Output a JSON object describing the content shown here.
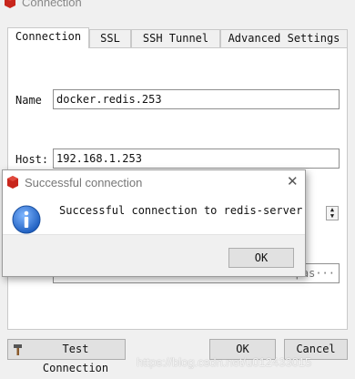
{
  "window": {
    "title": "Connection"
  },
  "tabs": [
    {
      "label": "Connection"
    },
    {
      "label": "SSL"
    },
    {
      "label": "SSH Tunnel"
    },
    {
      "label": "Advanced Settings"
    }
  ],
  "form": {
    "name_label": "Name",
    "name_value": "docker.redis.253",
    "host_label": "Host:",
    "host_value": "192.168.1.253",
    "auth_value_partial": "pas···"
  },
  "buttons": {
    "test_connection": "Test Connection",
    "ok": "OK",
    "cancel": "Cancel"
  },
  "watermark": "https://blog.csdn.net/u012433015",
  "dialog": {
    "title": "Successful connection",
    "message": "Successful connection to redis-server",
    "ok": "OK",
    "close_symbol": "✕"
  },
  "colors": {
    "redis_red": "#c8261c",
    "info_blue": "#1f6fd0"
  }
}
